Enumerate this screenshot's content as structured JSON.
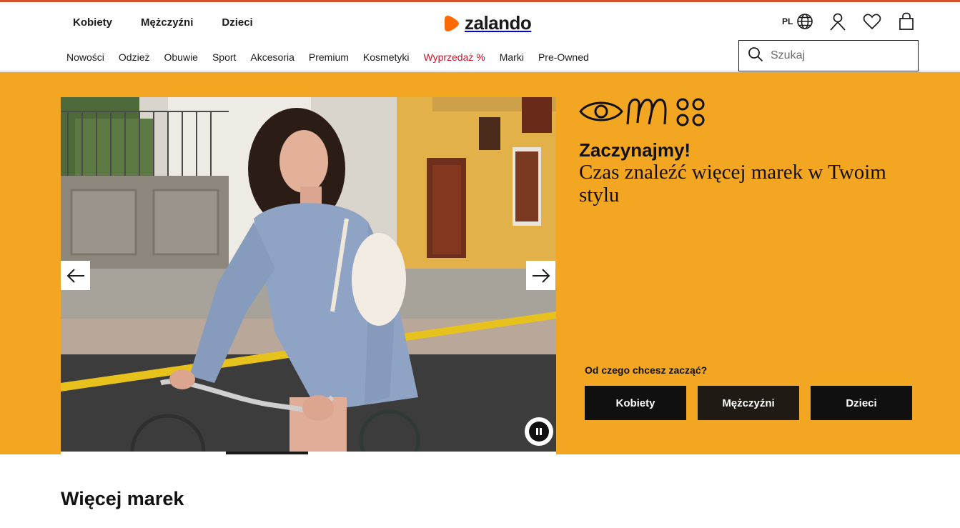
{
  "header": {
    "gender_nav": [
      "Kobiety",
      "Mężczyźni",
      "Dzieci"
    ],
    "logo_text": "zalando",
    "lang": "PL",
    "categories": [
      "Nowości",
      "Odzież",
      "Obuwie",
      "Sport",
      "Akcesoria",
      "Premium",
      "Kosmetyki",
      "Wyprzedaż %",
      "Marki",
      "Pre-Owned"
    ],
    "search_placeholder": "Szukaj",
    "icons": [
      "globe-icon",
      "user-icon",
      "heart-icon",
      "bag-icon",
      "search-icon"
    ]
  },
  "hero": {
    "title": "Zaczynajmy!",
    "subtitle": "Czas znaleźć więcej marek w Twoim stylu",
    "question": "Od czego chcesz zacząć?",
    "buttons": [
      "Kobiety",
      "Mężczyźni",
      "Dzieci"
    ],
    "carousel_progress": 0.33,
    "icons": [
      "arrow-left-icon",
      "arrow-right-icon",
      "pause-icon",
      "eye-icon",
      "loops-icon",
      "circles-icon"
    ]
  },
  "colors": {
    "accent_stripe": "#d4522a",
    "hero_background": "#f2a622",
    "sale": "#d0112b",
    "logo_orange": "#ff6900",
    "button_dark": "#101010"
  },
  "sections": {
    "more_brands_title": "Więcej marek"
  }
}
